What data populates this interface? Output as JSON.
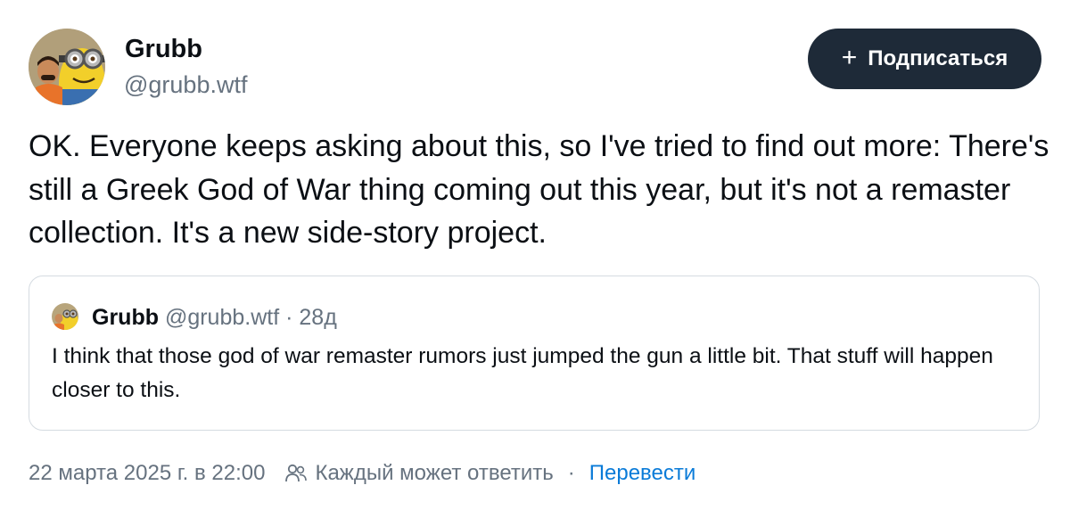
{
  "author": {
    "name": "Grubb",
    "handle": "@grubb.wtf",
    "avatar_icon": "minion-avatar"
  },
  "follow_button": {
    "icon": "plus-icon",
    "label": "Подписаться"
  },
  "post": {
    "text": "OK. Everyone keeps asking about this, so I've tried to find out more: There's still a Greek God of War thing coming out this year, but it's not a remaster collection. It's a new side-story project."
  },
  "quote": {
    "author_name": "Grubb",
    "author_handle": "@grubb.wtf",
    "separator": "·",
    "date": "28д",
    "text": "I think that those god of war remaster rumors just jumped the gun a little bit. That stuff will happen closer to this."
  },
  "footer": {
    "timestamp": "22 марта 2025 г. в 22:00",
    "reply_icon": "people-icon",
    "reply_setting": "Каждый может ответить",
    "separator": "·",
    "translate_label": "Перевести"
  },
  "colors": {
    "button_bg": "#1e2a38",
    "muted_text": "#66727f",
    "link": "#0a7bd8",
    "border": "#d5dbe1"
  }
}
